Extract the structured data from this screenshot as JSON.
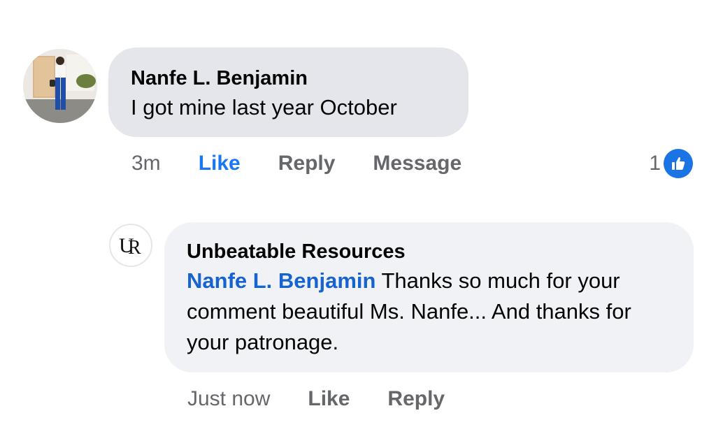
{
  "comment": {
    "author": "Nanfe L. Benjamin",
    "text": "I got mine last year October",
    "actions": {
      "time": "3m",
      "like": "Like",
      "reply": "Reply",
      "message": "Message"
    },
    "reaction_count": "1",
    "reaction_icon": "thumbs-up-icon",
    "like_color": "#1877f2"
  },
  "reply": {
    "author": "Unbeatable Resources",
    "avatar_logo": "UR",
    "mention": "Nanfe L. Benjamin",
    "text": " Thanks so much for your comment beautiful Ms. Nanfe... And thanks for your patronage.",
    "actions": {
      "time": "Just now",
      "like": "Like",
      "reply": "Reply"
    },
    "mention_color": "#1763cf"
  }
}
